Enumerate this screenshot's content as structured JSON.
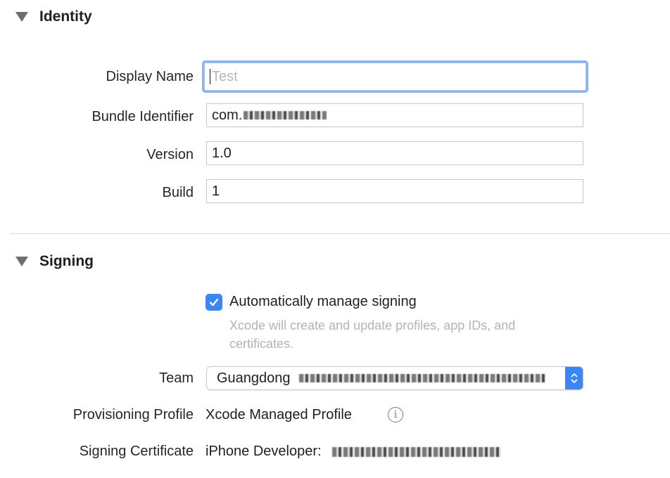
{
  "identity": {
    "title": "Identity",
    "display_name": {
      "label": "Display Name",
      "placeholder": "Test",
      "value": ""
    },
    "bundle_identifier": {
      "label": "Bundle Identifier",
      "value": "com."
    },
    "version": {
      "label": "Version",
      "value": "1.0"
    },
    "build": {
      "label": "Build",
      "value": "1"
    }
  },
  "signing": {
    "title": "Signing",
    "auto_manage": {
      "label": "Automatically manage signing",
      "checked": true,
      "help": "Xcode will create and update profiles, app IDs, and certificates."
    },
    "team": {
      "label": "Team",
      "value": "Guangdong"
    },
    "provisioning_profile": {
      "label": "Provisioning Profile",
      "value": "Xcode Managed Profile"
    },
    "signing_certificate": {
      "label": "Signing Certificate",
      "value": "iPhone Developer:"
    }
  },
  "colors": {
    "accent": "#3b86f7",
    "focus_ring": "#8ab3f3",
    "help_text": "#b3b3b3"
  },
  "icons": {
    "disclosure": "disclosure-triangle-down-icon",
    "checkbox": "checkmark-icon",
    "stepper": "up-down-chevron-icon",
    "info": "info-circle-icon"
  }
}
